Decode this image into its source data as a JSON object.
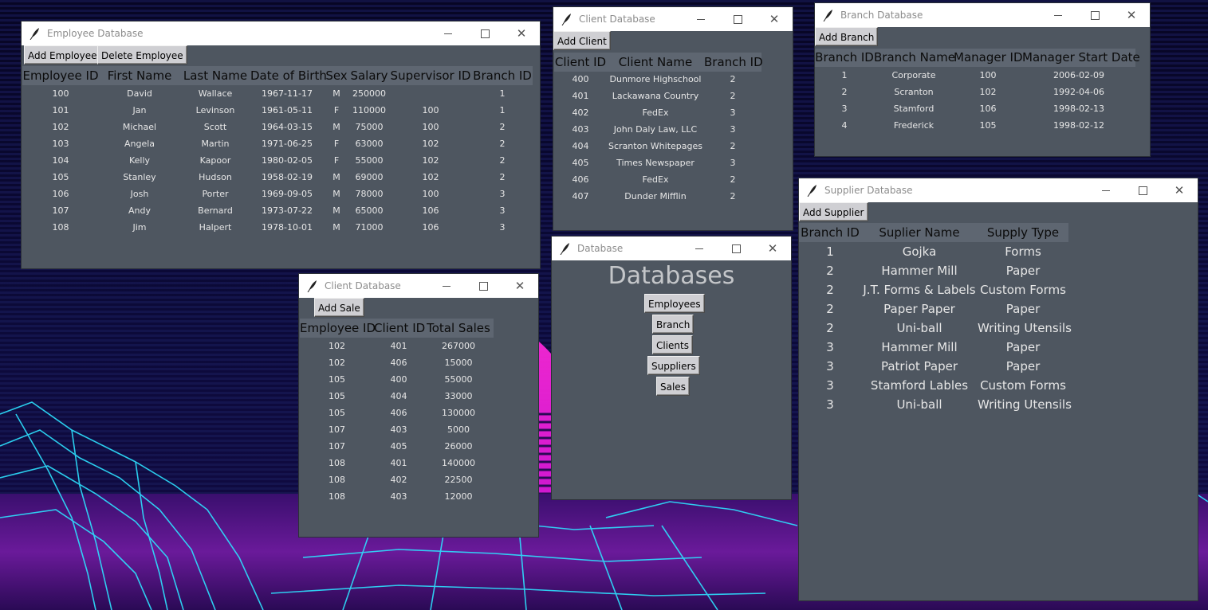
{
  "colors": {
    "window_body": "#4e5660",
    "header_bg": "#5e6671",
    "button_bg": "#cfcfd3",
    "synthwave_pink": "#ff2bd6",
    "synthwave_cyan": "#2de2ff"
  },
  "icons": {
    "window_icon": "feather-icon",
    "minimize": "minimize-icon",
    "maximize": "maximize-icon",
    "close": "close-icon"
  },
  "employee": {
    "title": "Employee Database",
    "buttons": {
      "add": "Add Employee",
      "delete": "Delete Employee"
    },
    "headers": [
      "Employee ID",
      "First Name",
      "Last Name",
      "Date of Birth",
      "Sex",
      "Salary",
      "Supervisor ID",
      "Branch ID"
    ],
    "rows": [
      [
        "100",
        "David",
        "Wallace",
        "1967-11-17",
        "M",
        "250000",
        "",
        "1"
      ],
      [
        "101",
        "Jan",
        "Levinson",
        "1961-05-11",
        "F",
        "110000",
        "100",
        "1"
      ],
      [
        "102",
        "Michael",
        "Scott",
        "1964-03-15",
        "M",
        "75000",
        "100",
        "2"
      ],
      [
        "103",
        "Angela",
        "Martin",
        "1971-06-25",
        "F",
        "63000",
        "102",
        "2"
      ],
      [
        "104",
        "Kelly",
        "Kapoor",
        "1980-02-05",
        "F",
        "55000",
        "102",
        "2"
      ],
      [
        "105",
        "Stanley",
        "Hudson",
        "1958-02-19",
        "M",
        "69000",
        "102",
        "2"
      ],
      [
        "106",
        "Josh",
        "Porter",
        "1969-09-05",
        "M",
        "78000",
        "100",
        "3"
      ],
      [
        "107",
        "Andy",
        "Bernard",
        "1973-07-22",
        "M",
        "65000",
        "106",
        "3"
      ],
      [
        "108",
        "Jim",
        "Halpert",
        "1978-10-01",
        "M",
        "71000",
        "106",
        "3"
      ]
    ]
  },
  "client": {
    "title": "Client Database",
    "buttons": {
      "add": "Add Client"
    },
    "headers": [
      "Client ID",
      "Client Name",
      "Branch ID"
    ],
    "rows": [
      [
        "400",
        "Dunmore Highschool",
        "2"
      ],
      [
        "401",
        "Lackawana Country",
        "2"
      ],
      [
        "402",
        "FedEx",
        "3"
      ],
      [
        "403",
        "John Daly Law, LLC",
        "3"
      ],
      [
        "404",
        "Scranton Whitepages",
        "2"
      ],
      [
        "405",
        "Times Newspaper",
        "3"
      ],
      [
        "406",
        "FedEx",
        "2"
      ],
      [
        "407",
        "Dunder Mifflin",
        "2"
      ]
    ]
  },
  "branch": {
    "title": "Branch Database",
    "buttons": {
      "add": "Add Branch"
    },
    "headers": [
      "Branch ID",
      "Branch Name",
      "Manager ID",
      "Manager Start Date"
    ],
    "rows": [
      [
        "1",
        "Corporate",
        "100",
        "2006-02-09"
      ],
      [
        "2",
        "Scranton",
        "102",
        "1992-04-06"
      ],
      [
        "3",
        "Stamford",
        "106",
        "1998-02-13"
      ],
      [
        "4",
        "Frederick",
        "105",
        "1998-02-12"
      ]
    ]
  },
  "sales": {
    "title": "Client Database",
    "buttons": {
      "add": "Add Sale"
    },
    "headers": [
      "Employee ID",
      "Client ID",
      "Total Sales"
    ],
    "rows": [
      [
        "102",
        "401",
        "267000"
      ],
      [
        "102",
        "406",
        "15000"
      ],
      [
        "105",
        "400",
        "55000"
      ],
      [
        "105",
        "404",
        "33000"
      ],
      [
        "105",
        "406",
        "130000"
      ],
      [
        "107",
        "403",
        "5000"
      ],
      [
        "107",
        "405",
        "26000"
      ],
      [
        "108",
        "401",
        "140000"
      ],
      [
        "108",
        "402",
        "22500"
      ],
      [
        "108",
        "403",
        "12000"
      ]
    ]
  },
  "main": {
    "title": "Database",
    "heading": "Databases",
    "buttons": [
      "Employees",
      "Branch",
      "Clients",
      "Suppliers",
      "Sales"
    ]
  },
  "supplier": {
    "title": "Supplier Database",
    "buttons": {
      "add": "Add Supplier"
    },
    "headers": [
      "Branch ID",
      "Suplier Name",
      "Supply Type"
    ],
    "rows": [
      [
        "1",
        "Gojka",
        "Forms"
      ],
      [
        "2",
        "Hammer Mill",
        "Paper"
      ],
      [
        "2",
        "J.T. Forms & Labels",
        "Custom Forms"
      ],
      [
        "2",
        "Paper Paper",
        "Paper"
      ],
      [
        "2",
        "Uni-ball",
        "Writing Utensils"
      ],
      [
        "3",
        "Hammer Mill",
        "Paper"
      ],
      [
        "3",
        "Patriot Paper",
        "Paper"
      ],
      [
        "3",
        "Stamford Lables",
        "Custom Forms"
      ],
      [
        "3",
        "Uni-ball",
        "Writing Utensils"
      ]
    ]
  }
}
